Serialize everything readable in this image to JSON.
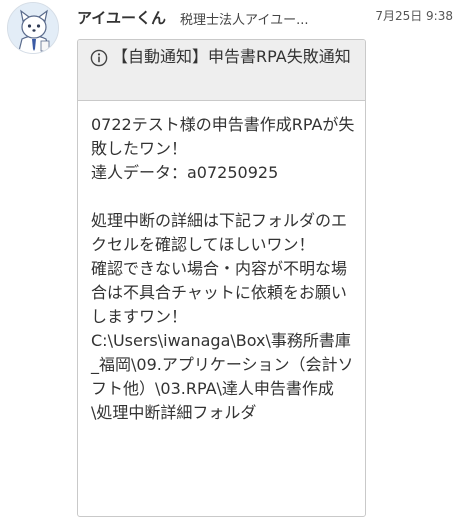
{
  "message": {
    "sender": {
      "name": "アイユーくん",
      "organization": "税理士法人アイユー..."
    },
    "timestamp": "7月25日 9:38",
    "card": {
      "icon": "info-icon",
      "title": "【自動通知】申告書RPA失敗通知",
      "body_lines": [
        "0722テスト様の申告書作成RPAが失敗したワン！",
        "達人データ：a07250925",
        "",
        "処理中断の詳細は下記フォルダのエクセルを確認してほしいワン！",
        "確認できない場合・内容が不明な場合は不具合チャットに依頼をお願いしますワン！",
        "C:\\Users\\iwanaga\\Box\\事務所書庫_福岡\\09.アプリケーション（会計ソフト他）\\03.RPA\\達人申告書作成\\処理中断詳細フォルダ"
      ]
    }
  },
  "colors": {
    "card_header_bg": "#eeeeee",
    "card_border": "#c9c9c9",
    "text": "#333333"
  }
}
